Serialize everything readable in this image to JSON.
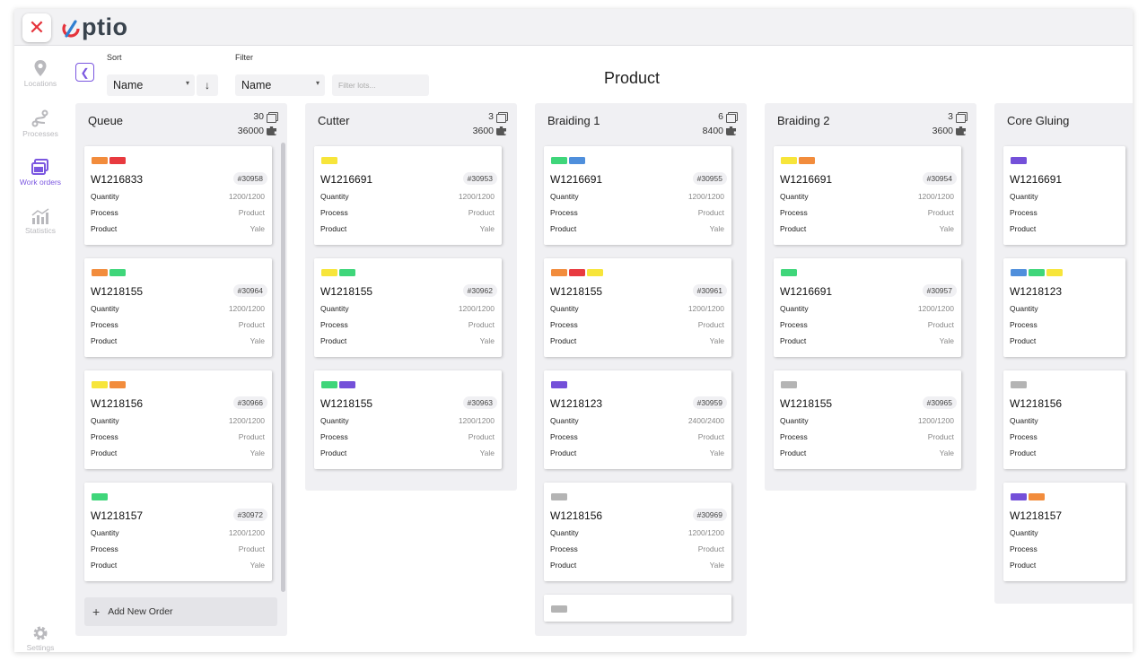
{
  "app": {
    "logo_text": "ptio",
    "close_icon": "close-icon"
  },
  "sidebar": {
    "items": [
      {
        "label": "Locations",
        "icon": "location-pin-icon",
        "active": false
      },
      {
        "label": "Processes",
        "icon": "route-icon",
        "active": false
      },
      {
        "label": "Work orders",
        "icon": "work-orders-icon",
        "active": true
      },
      {
        "label": "Statistics",
        "icon": "statistics-icon",
        "active": false
      }
    ],
    "settings_label": "Settings"
  },
  "toolbar": {
    "sort_label": "Sort",
    "sort_value": "Name",
    "sort_direction": "↓",
    "filter_label": "Filter",
    "filter_value": "Name",
    "filter_placeholder": "Filter lots..."
  },
  "page_title": "Product",
  "field_labels": {
    "quantity": "Quantity",
    "process": "Process",
    "product": "Product"
  },
  "add_order_label": "Add New Order",
  "colors": {
    "orange": "#f28c3c",
    "red": "#e83a3f",
    "yellow": "#f7e53a",
    "green": "#3fd67a",
    "blue": "#4f8fdc",
    "purple": "#7450d9",
    "gray": "#b4b4b4",
    "accent": "#7b57e0"
  },
  "columns": [
    {
      "title": "Queue",
      "count": "30",
      "total": "36000",
      "cards": [
        {
          "order": "W1216833",
          "lot": "#30958",
          "quantity": "1200/1200",
          "process": "Product",
          "product": "Yale",
          "tags": [
            "orange",
            "red"
          ]
        },
        {
          "order": "W1218155",
          "lot": "#30964",
          "quantity": "1200/1200",
          "process": "Product",
          "product": "Yale",
          "tags": [
            "orange",
            "green"
          ]
        },
        {
          "order": "W1218156",
          "lot": "#30966",
          "quantity": "1200/1200",
          "process": "Product",
          "product": "Yale",
          "tags": [
            "yellow",
            "orange"
          ]
        },
        {
          "order": "W1218157",
          "lot": "#30972",
          "quantity": "1200/1200",
          "process": "Product",
          "product": "Yale",
          "tags": [
            "green"
          ]
        }
      ]
    },
    {
      "title": "Cutter",
      "count": "3",
      "total": "3600",
      "cards": [
        {
          "order": "W1216691",
          "lot": "#30953",
          "quantity": "1200/1200",
          "process": "Product",
          "product": "Yale",
          "tags": [
            "yellow"
          ]
        },
        {
          "order": "W1218155",
          "lot": "#30962",
          "quantity": "1200/1200",
          "process": "Product",
          "product": "Yale",
          "tags": [
            "yellow",
            "green"
          ]
        },
        {
          "order": "W1218155",
          "lot": "#30963",
          "quantity": "1200/1200",
          "process": "Product",
          "product": "Yale",
          "tags": [
            "green",
            "purple"
          ]
        }
      ]
    },
    {
      "title": "Braiding 1",
      "count": "6",
      "total": "8400",
      "cards": [
        {
          "order": "W1216691",
          "lot": "#30955",
          "quantity": "1200/1200",
          "process": "Product",
          "product": "Yale",
          "tags": [
            "green",
            "blue"
          ]
        },
        {
          "order": "W1218155",
          "lot": "#30961",
          "quantity": "1200/1200",
          "process": "Product",
          "product": "Yale",
          "tags": [
            "orange",
            "red",
            "yellow"
          ]
        },
        {
          "order": "W1218123",
          "lot": "#30959",
          "quantity": "2400/2400",
          "process": "Product",
          "product": "Yale",
          "tags": [
            "purple"
          ]
        },
        {
          "order": "W1218156",
          "lot": "#30969",
          "quantity": "1200/1200",
          "process": "Product",
          "product": "Yale",
          "tags": [
            "gray"
          ]
        },
        {
          "order": "",
          "lot": "",
          "quantity": "",
          "process": "",
          "product": "",
          "tags": [
            "gray"
          ]
        }
      ]
    },
    {
      "title": "Braiding 2",
      "count": "3",
      "total": "3600",
      "cards": [
        {
          "order": "W1216691",
          "lot": "#30954",
          "quantity": "1200/1200",
          "process": "Product",
          "product": "Yale",
          "tags": [
            "yellow",
            "orange"
          ]
        },
        {
          "order": "W1216691",
          "lot": "#30957",
          "quantity": "1200/1200",
          "process": "Product",
          "product": "Yale",
          "tags": [
            "green"
          ]
        },
        {
          "order": "W1218155",
          "lot": "#30965",
          "quantity": "1200/1200",
          "process": "Product",
          "product": "Yale",
          "tags": [
            "gray"
          ]
        }
      ]
    },
    {
      "title": "Core Gluing",
      "count": "",
      "total": "",
      "cards": [
        {
          "order": "W1216691",
          "lot": "",
          "quantity": "",
          "process": "",
          "product": "",
          "tags": [
            "purple"
          ]
        },
        {
          "order": "W1218123",
          "lot": "",
          "quantity": "",
          "process": "",
          "product": "",
          "tags": [
            "blue",
            "green",
            "yellow"
          ]
        },
        {
          "order": "W1218156",
          "lot": "",
          "quantity": "",
          "process": "",
          "product": "",
          "tags": [
            "gray"
          ]
        },
        {
          "order": "W1218157",
          "lot": "",
          "quantity": "",
          "process": "",
          "product": "",
          "tags": [
            "purple",
            "orange"
          ]
        }
      ]
    }
  ]
}
